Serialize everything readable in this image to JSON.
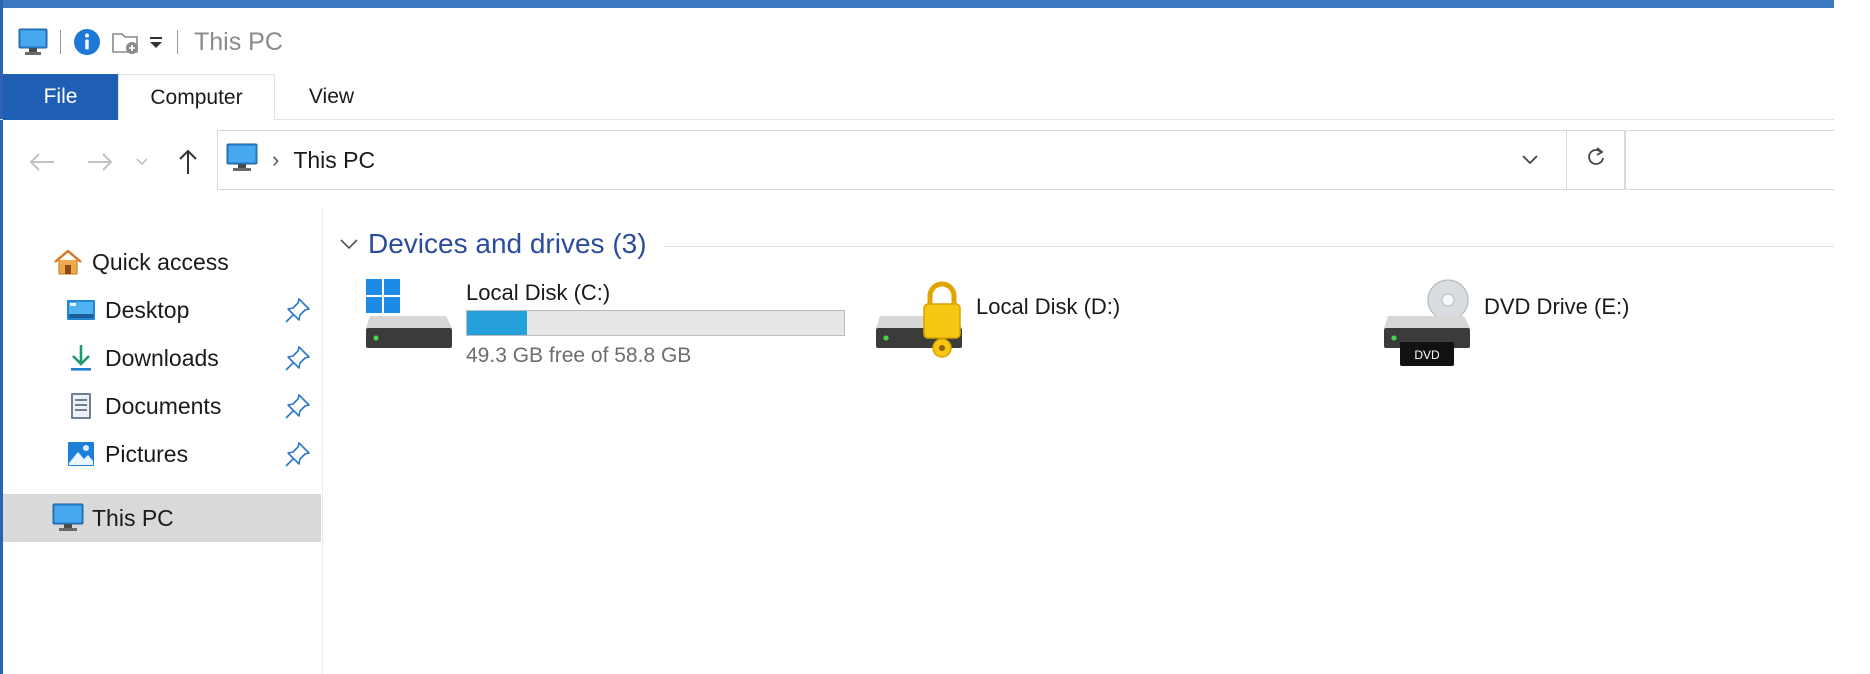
{
  "window": {
    "title": "This PC",
    "accent_color": "#1e5fb4"
  },
  "quick_access_toolbar": {
    "icons": [
      "this-pc-icon",
      "properties-icon",
      "new-folder-icon",
      "customize-dropdown-icon"
    ]
  },
  "ribbon": {
    "tabs": [
      {
        "label": "File",
        "active": false
      },
      {
        "label": "Computer",
        "active": true
      },
      {
        "label": "View",
        "active": false
      }
    ]
  },
  "navigation": {
    "back_icon": "back-arrow-icon",
    "forward_icon": "forward-arrow-icon",
    "recent_icon": "chevron-down-icon",
    "up_icon": "up-arrow-icon"
  },
  "address_bar": {
    "crumbs": [
      "This PC"
    ],
    "dropdown_icon": "chevron-down-icon",
    "refresh_icon": "refresh-icon"
  },
  "search": {
    "placeholder": "",
    "value": ""
  },
  "nav_pane": {
    "quick_access": {
      "label": "Quick access",
      "icon": "home-icon"
    },
    "pinned": [
      {
        "label": "Desktop",
        "icon": "desktop-icon",
        "pinned": true
      },
      {
        "label": "Downloads",
        "icon": "download-icon",
        "pinned": true
      },
      {
        "label": "Documents",
        "icon": "document-icon",
        "pinned": true
      },
      {
        "label": "Pictures",
        "icon": "pictures-icon",
        "pinned": true
      }
    ],
    "this_pc": {
      "label": "This PC",
      "icon": "this-pc-icon",
      "selected": true
    }
  },
  "content": {
    "group": {
      "title": "Devices and drives (3)",
      "chevron_icon": "chevron-down-icon"
    },
    "drives": [
      {
        "name": "Local Disk (C:)",
        "icon": "windows-drive-icon",
        "free_text": "49.3 GB free of 58.8 GB",
        "used_fraction": 0.16,
        "bar_color": "#26a0da"
      },
      {
        "name": "Local Disk (D:)",
        "icon": "locked-drive-icon"
      },
      {
        "name": "DVD Drive (E:)",
        "icon": "dvd-drive-icon",
        "badge": "DVD"
      }
    ]
  }
}
